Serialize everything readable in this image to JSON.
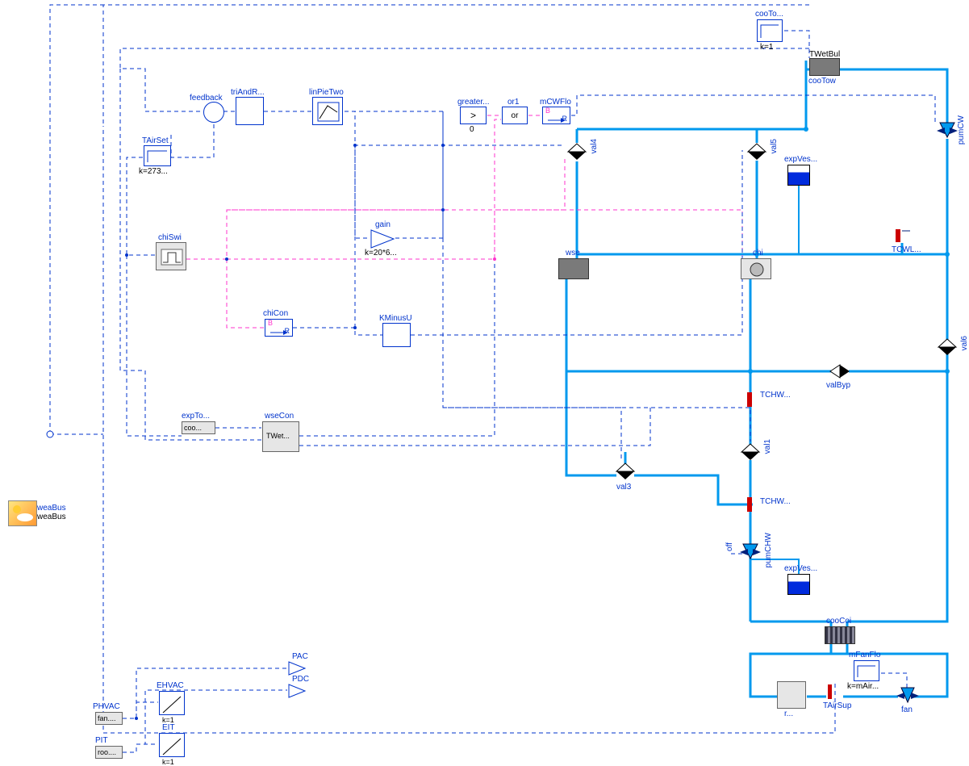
{
  "domain": "Diagram",
  "description": "Modelica system diagram of HVAC / chiller plant with cooling tower, water-side economizer, chiller, cooling coil and fan; control signals dashed blue/pink, fluid pipes cyan.",
  "blocks": {
    "cooTo": {
      "label": "cooTo...",
      "param": "k=1"
    },
    "TWetBul": {
      "label": "TWetBul"
    },
    "cooTow": {
      "label": "cooTow"
    },
    "pumCW": {
      "label": "pumCW"
    },
    "feedback": {
      "label": "feedback"
    },
    "triAndR": {
      "label": "triAndR..."
    },
    "linPieTwo": {
      "label": "linPieTwo"
    },
    "greater": {
      "label": "greater...",
      "param": "0"
    },
    "or1": {
      "label": "or1",
      "text": "or"
    },
    "mCWFlo": {
      "label": "mCWFlo",
      "b": "B",
      "r": "R"
    },
    "TAirSet": {
      "label": "TAirSet",
      "param": "k=273..."
    },
    "val4": {
      "label": "val4"
    },
    "val5": {
      "label": "val5"
    },
    "expVes1": {
      "label": "expVes..."
    },
    "chiSwi": {
      "label": "chiSwi"
    },
    "gain": {
      "label": "gain",
      "param": "k=20*6..."
    },
    "wse": {
      "label": "wse"
    },
    "chi": {
      "label": "chi"
    },
    "TCWL": {
      "label": "TCWL..."
    },
    "chiCon": {
      "label": "chiCon",
      "b": "B",
      "r": "R"
    },
    "KMinusU": {
      "label": "KMinusU"
    },
    "val6": {
      "label": "val6"
    },
    "valByp": {
      "label": "valByp"
    },
    "TCHW1": {
      "label": "TCHW..."
    },
    "val1": {
      "label": "val1"
    },
    "expTo": {
      "label": "expTo...",
      "text": "coo..."
    },
    "wseCon": {
      "label": "wseCon",
      "text": "TWet..."
    },
    "val3": {
      "label": "val3"
    },
    "TCHW2": {
      "label": "TCHW..."
    },
    "pumCHW": {
      "label": "pumCHW"
    },
    "off": {
      "label": "off"
    },
    "expVes2": {
      "label": "expVes..."
    },
    "cooCoi": {
      "label": "cooCoi"
    },
    "mFanFlo": {
      "label": "mFanFlo",
      "param": "k=mAir..."
    },
    "TAirSup": {
      "label": "TAirSup"
    },
    "fan": {
      "label": "fan"
    },
    "r": {
      "label": "r..."
    },
    "weaBus": {
      "label": "weaBus",
      "alt": "weaBus"
    },
    "PAC": {
      "label": "PAC"
    },
    "PDC": {
      "label": "PDC"
    },
    "PHVAC": {
      "label": "PHVAC",
      "text": "fan...."
    },
    "PIT": {
      "label": "PIT",
      "text": "roo...."
    },
    "EHVAC": {
      "label": "EHVAC",
      "param": "k=1"
    },
    "EIT": {
      "label": "EIT",
      "param": "k=1"
    }
  }
}
